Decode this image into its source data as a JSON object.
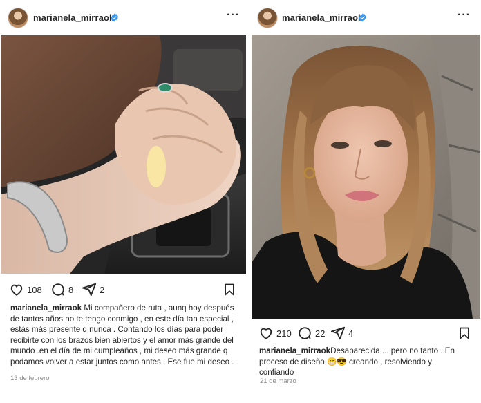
{
  "posts": [
    {
      "username": "marianela_mirraok",
      "verified": true,
      "image_alt": "Dos manos entrelazadas sobre la palanca de cambios de un auto",
      "likes": "108",
      "comments": "8",
      "shares": "2",
      "caption_username": "marianela_mirraok",
      "caption_text": "Mi compañero de ruta , aunq hoy después de tantos años no te tengo conmigo , en este día tan especial , estás más presente q nunca . Contando los días para poder recibirte con los brazos bien abiertos y el amor más grande del mundo .en el día de mi cumpleaños , mi deseo más grande q podamos volver a estar juntos como antes . Ese fue mi deseo .",
      "date": "13 de febrero"
    },
    {
      "username": "marianela_mirraok",
      "verified": true,
      "image_alt": "Selfie de mujer con flequillo y cabello largo castaño claro frente a una pared de piedra",
      "likes": "210",
      "comments": "22",
      "shares": "4",
      "caption_username": "marianela_mirraok",
      "caption_text": "Desaparecida ... pero no tanto . En proceso de diseño 😁😎 creando , resolviendo y confiando",
      "date": "21 de marzo"
    }
  ],
  "icons": {
    "verified": "verified-badge-icon",
    "more": "more-options-icon",
    "like": "heart-icon",
    "comment": "comment-bubble-icon",
    "share": "paper-plane-icon",
    "save": "bookmark-icon"
  },
  "colors": {
    "verified": "#3897f0",
    "text": "#262626",
    "muted": "#8e8e8e"
  }
}
